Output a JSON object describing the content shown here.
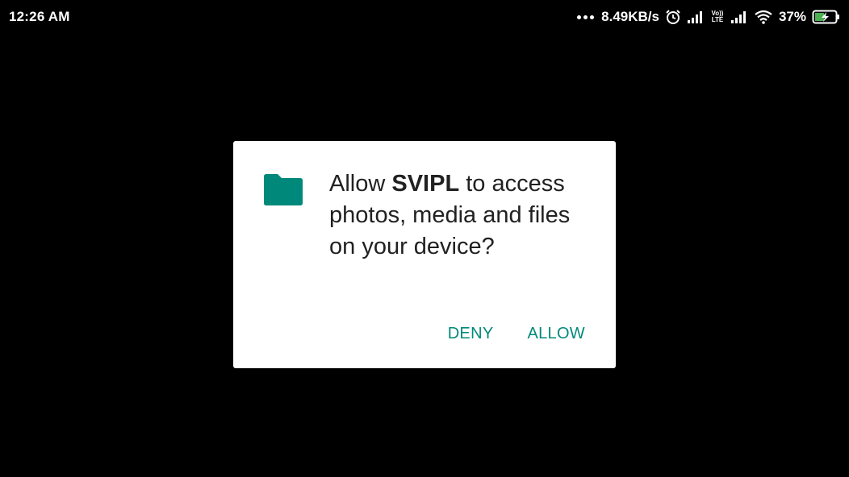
{
  "status_bar": {
    "time": "12:26 AM",
    "net_speed": "8.49KB/s",
    "volte_top": "Vo))",
    "volte_bottom": "LTE",
    "battery_percent": "37%"
  },
  "dialog": {
    "message_prefix": "Allow ",
    "app_name": "SVIPL",
    "message_suffix": " to access photos, media and files on your device?",
    "deny_label": "DENY",
    "allow_label": "ALLOW"
  },
  "colors": {
    "accent": "#00897b",
    "background": "#000000",
    "dialog_bg": "#ffffff",
    "text": "#212121"
  },
  "icons": {
    "dialog_icon": "folder-icon"
  }
}
